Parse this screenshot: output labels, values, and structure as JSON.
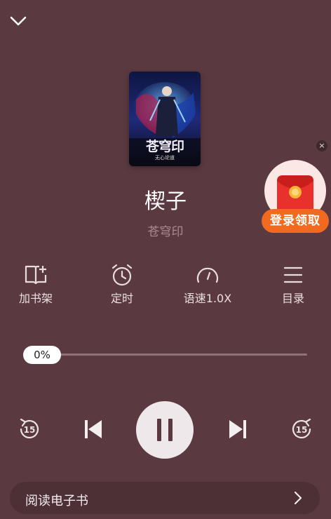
{
  "book": {
    "title": "楔子",
    "author": "苍穹印",
    "cover_title": "苍穹印",
    "cover_subtitle": "无心论道"
  },
  "promo": {
    "label": "登录领取",
    "close": "×"
  },
  "actions": [
    {
      "label": "加书架",
      "icon": "bookshelf-add-icon"
    },
    {
      "label": "定时",
      "icon": "alarm-clock-icon"
    },
    {
      "label": "语速1.0X",
      "icon": "speedometer-icon"
    },
    {
      "label": "目录",
      "icon": "menu-list-icon"
    }
  ],
  "progress": {
    "label": "0%",
    "value": 0
  },
  "controls": {
    "rewind_seconds": "15",
    "forward_seconds": "15",
    "state": "playing"
  },
  "read_ebook": {
    "label": "阅读电子书"
  },
  "colors": {
    "background": "#5a3a40",
    "promo_orange": "#f26a1f",
    "accent_red": "#e8302c"
  }
}
